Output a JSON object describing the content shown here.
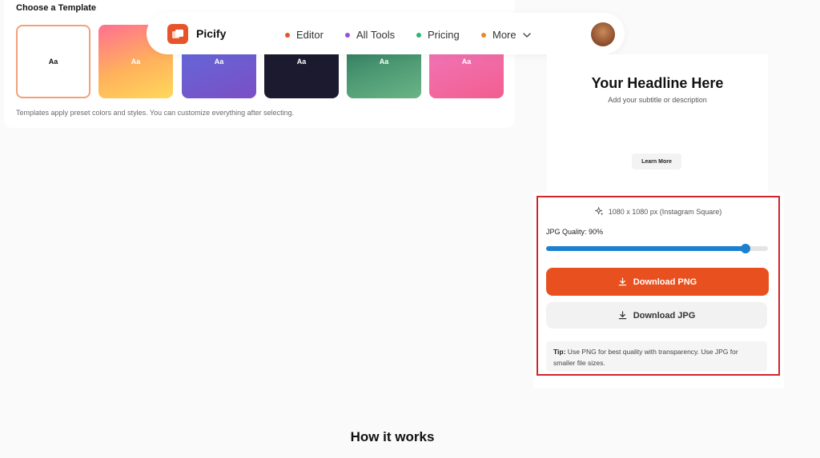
{
  "templates": {
    "title": "Choose a Template",
    "sample_text": "Aa",
    "items": [
      "Aa",
      "Aa",
      "Aa",
      "Aa",
      "Aa",
      "Aa"
    ],
    "note": "Templates apply preset colors and styles. You can customize everything after selecting."
  },
  "nav": {
    "brand": "Picify",
    "items": [
      {
        "label": "Editor",
        "color": "#e8542a"
      },
      {
        "label": "All Tools",
        "color": "#9b4fd6"
      },
      {
        "label": "Pricing",
        "color": "#2bb673"
      },
      {
        "label": "More",
        "color": "#e8892a"
      }
    ]
  },
  "preview": {
    "headline": "Your Headline Here",
    "subtitle": "Add your subtitle or description",
    "button": "Learn More"
  },
  "export": {
    "size_info": "1080 x 1080 px (Instagram Square)",
    "quality_label": "JPG Quality: 90%",
    "quality_value": 90,
    "download_png": "Download PNG",
    "download_jpg": "Download JPG",
    "tip_label": "Tip:",
    "tip_text": " Use PNG for best quality with transparency. Use JPG for smaller file sizes.",
    "accent": "#e8501f",
    "highlight": "#d4222a"
  },
  "section": {
    "how_title": "How it works"
  }
}
